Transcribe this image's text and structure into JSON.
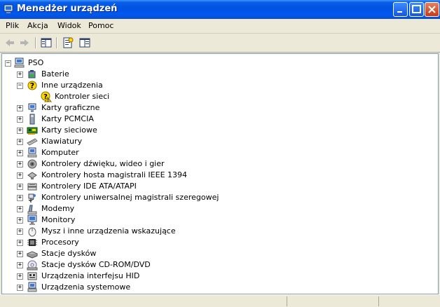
{
  "window": {
    "title": "Menedżer urządzeń"
  },
  "menubar": {
    "items": [
      "Plik",
      "Akcja",
      "Widok",
      "Pomoc"
    ]
  },
  "toolbar": {
    "buttons": [
      "back-icon",
      "forward-icon",
      "show-hide-tree-icon",
      "properties-icon",
      "console-tree-icon"
    ]
  },
  "tree": {
    "root": {
      "label": "PSO",
      "expanded": true,
      "icon": "computer-icon"
    },
    "categories": [
      {
        "label": "Baterie",
        "icon": "battery-icon",
        "expanded": false
      },
      {
        "label": "Inne urządzenia",
        "icon": "unknown-device-icon",
        "expanded": true,
        "children": [
          {
            "label": "Kontroler sieci",
            "icon": "warning-device-icon"
          }
        ]
      },
      {
        "label": "Karty graficzne",
        "icon": "display-adapter-icon",
        "expanded": false
      },
      {
        "label": "Karty PCMCIA",
        "icon": "pcmcia-icon",
        "expanded": false
      },
      {
        "label": "Karty sieciowe",
        "icon": "network-card-icon",
        "expanded": false
      },
      {
        "label": "Klawiatury",
        "icon": "keyboard-icon",
        "expanded": false
      },
      {
        "label": "Komputer",
        "icon": "computer-icon",
        "expanded": false
      },
      {
        "label": "Kontrolery dźwięku, wideo i gier",
        "icon": "sound-icon",
        "expanded": false
      },
      {
        "label": "Kontrolery hosta magistrali IEEE 1394",
        "icon": "ieee1394-icon",
        "expanded": false
      },
      {
        "label": "Kontrolery IDE ATA/ATAPI",
        "icon": "ide-controller-icon",
        "expanded": false
      },
      {
        "label": "Kontrolery uniwersalnej magistrali szeregowej",
        "icon": "usb-icon",
        "expanded": false
      },
      {
        "label": "Modemy",
        "icon": "modem-icon",
        "expanded": false
      },
      {
        "label": "Monitory",
        "icon": "monitor-icon",
        "expanded": false
      },
      {
        "label": "Mysz i inne urządzenia wskazujące",
        "icon": "mouse-icon",
        "expanded": false
      },
      {
        "label": "Procesory",
        "icon": "processor-icon",
        "expanded": false
      },
      {
        "label": "Stacje dysków",
        "icon": "disk-drive-icon",
        "expanded": false
      },
      {
        "label": "Stacje dysków CD-ROM/DVD",
        "icon": "cdrom-icon",
        "expanded": false
      },
      {
        "label": "Urządzenia interfejsu HID",
        "icon": "hid-icon",
        "expanded": false
      },
      {
        "label": "Urządzenia systemowe",
        "icon": "system-device-icon",
        "expanded": false
      }
    ]
  },
  "colors": {
    "titlebar": "#0053e1",
    "accent": "#316ac5",
    "warning": "#ffd800"
  }
}
